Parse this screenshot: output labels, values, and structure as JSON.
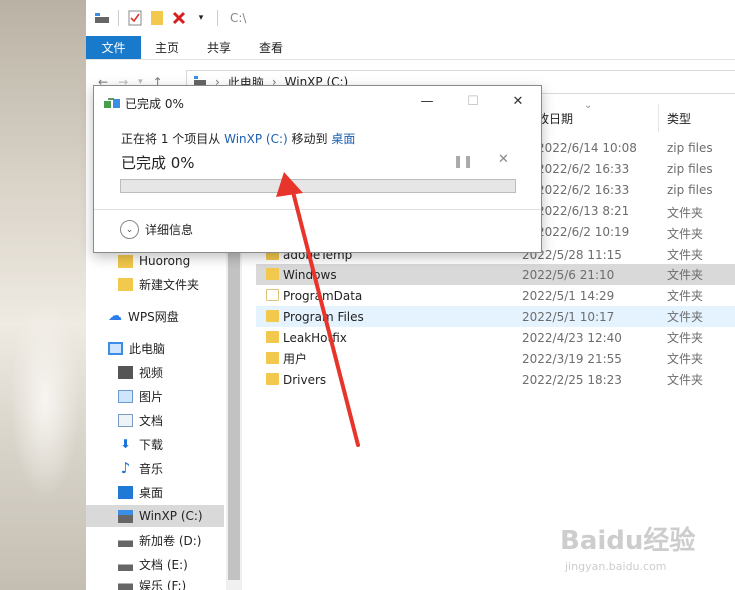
{
  "quick_access": {
    "path": "C:\\"
  },
  "ribbon": {
    "tabs": [
      "文件",
      "主页",
      "共享",
      "查看"
    ]
  },
  "address": {
    "segments": [
      "此电脑",
      "WinXP (C:)"
    ]
  },
  "columns": {
    "date": "改日期",
    "type": "类型"
  },
  "top_rows": [
    {
      "date": "2022/6/14 10:08",
      "type": "zip files"
    },
    {
      "date": "2022/6/2 16:33",
      "type": "zip files"
    },
    {
      "date": "2022/6/2 16:33",
      "type": "zip files"
    },
    {
      "date": "2022/6/13 8:21",
      "type": "文件夹"
    },
    {
      "date": "2022/6/2 10:19",
      "type": "文件夹"
    }
  ],
  "files": [
    {
      "name": "adobeTemp",
      "date": "2022/5/28 11:15",
      "type": "文件夹"
    },
    {
      "name": "Windows",
      "date": "2022/5/6 21:10",
      "type": "文件夹"
    },
    {
      "name": "ProgramData",
      "date": "2022/5/1 14:29",
      "type": "文件夹"
    },
    {
      "name": "Program Files",
      "date": "2022/5/1 10:17",
      "type": "文件夹"
    },
    {
      "name": "LeakHotfix",
      "date": "2022/4/23 12:40",
      "type": "文件夹"
    },
    {
      "name": "用户",
      "date": "2022/3/19 21:55",
      "type": "文件夹"
    },
    {
      "name": "Drivers",
      "date": "2022/2/25 18:23",
      "type": "文件夹"
    }
  ],
  "sidebar": {
    "items": [
      {
        "label": "Huorong"
      },
      {
        "label": "新建文件夹"
      },
      {
        "label": "WPS网盘"
      },
      {
        "label": "此电脑"
      },
      {
        "label": "视频"
      },
      {
        "label": "图片"
      },
      {
        "label": "文档"
      },
      {
        "label": "下载"
      },
      {
        "label": "音乐"
      },
      {
        "label": "桌面"
      },
      {
        "label": "WinXP (C:)"
      },
      {
        "label": "新加卷 (D:)"
      },
      {
        "label": "文档 (E:)"
      },
      {
        "label": "娱乐 (F:)"
      }
    ]
  },
  "dialog": {
    "title": "已完成 0%",
    "desc_prefix": "正在将 1 个项目从 ",
    "source": "WinXP (C:)",
    "desc_mid": " 移动到 ",
    "dest": "桌面",
    "status": "已完成 0%",
    "progress_percent": 0,
    "more_label": "详细信息"
  },
  "watermark": {
    "brand": "Baidu经验",
    "url": "jingyan.baidu.com"
  },
  "colors": {
    "ribbon_file": "#1979ca",
    "link": "#1a5fb4",
    "arrow": "#e8352b",
    "folder": "#f2c94c"
  }
}
